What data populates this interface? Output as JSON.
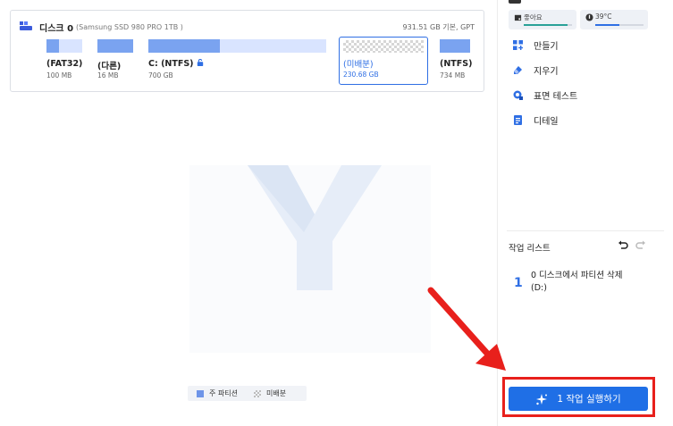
{
  "disk": {
    "name": "디스크 0",
    "model": "(Samsung SSD 980 PRO 1TB )",
    "info": "931.51 GB 기본, GPT",
    "partitions": [
      {
        "label": "(FAT32)",
        "size": "100 MB",
        "used_fraction": 0.35
      },
      {
        "label": "(다른)",
        "size": "16 MB",
        "used_fraction": 1.0
      },
      {
        "label": "C: (NTFS)",
        "size": "700 GB",
        "used_fraction": 0.4
      },
      {
        "label": "(미배분)",
        "size": "230.68 GB",
        "selected": true
      },
      {
        "label": "(NTFS)",
        "size": "734 MB",
        "used_fraction": 1.0
      }
    ]
  },
  "legend": {
    "primary": "주 파티션",
    "unallocated": "미배분"
  },
  "sidebar": {
    "health": {
      "label": "좋아요",
      "level": 0.9,
      "color": "#2aa198"
    },
    "temperature": {
      "label": "39°C",
      "level": 0.5,
      "color": "#2f6fe4"
    },
    "actions": [
      {
        "label": "만들기",
        "icon": "create-icon"
      },
      {
        "label": "지우기",
        "icon": "eraser-icon"
      },
      {
        "label": "표면 테스트",
        "icon": "surface-test-icon"
      },
      {
        "label": "디테일",
        "icon": "details-icon"
      }
    ],
    "task_list_title": "작업 리스트",
    "tasks": [
      {
        "num": "1",
        "text": "0 디스크에서 파티션 삭제(D:)"
      }
    ],
    "run_button": "1 작업 실행하기"
  },
  "colors": {
    "accent": "#1f6fe6",
    "annotation": "#e8201c"
  }
}
